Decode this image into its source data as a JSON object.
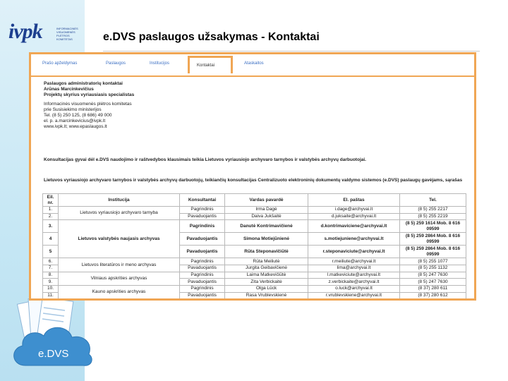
{
  "slide_title": "e.DVS paslaugos užsakymas - Kontaktai",
  "logo": {
    "main": "ivpk",
    "side_text": "INFORMACINĖS VISUOMENĖS PLĖTROS KOMITETAS"
  },
  "cloud_label": "e.DVS",
  "tabs": [
    {
      "label": "Prašo apželdymas"
    },
    {
      "label": "Paslaugos"
    },
    {
      "label": "Institucijos"
    },
    {
      "label": "Kontaktai"
    },
    {
      "label": "Ataskaitos"
    }
  ],
  "contacts": {
    "heading": "Paslaugos administratorių kontaktai",
    "name": "Arūnas Marcinkevičius",
    "position": "Projektų skyrius vyriausiasis specialistas",
    "org_line1": "Informacinės visuomenės plėtros komitetas",
    "org_line2": "prie Susisiekimo ministerijos",
    "phone": "Tel. (8 5) 250 125, (8 686) 49 000",
    "email": "el. p. a.marcinkevicius@ivpk.lt",
    "web": "www.ivpk.lt; www.epaslaugos.lt"
  },
  "consult_text": "Konsultacijas gyvai dėl e.DVS naudojimo ir raštvedybos klausimais teikia Lietuvos vyriausiojo archyvaro tarnybos ir valstybės archyvų darbuotojai.",
  "intro_text": "Lietuvos vyriausiojo archyvaro tarnybos ir valstybės archyvų darbuotojų, teikiančių konsultacijas Centralizuoto elektroninių dokumentų valdymo sistemos (e.DVS) paslaugų gavėjams, sąrašas",
  "table": {
    "headers": [
      "Eil. nr.",
      "Institucija",
      "Konsultantai",
      "Vardas pavardė",
      "El. paštas",
      "Tel."
    ],
    "rows": [
      {
        "nr": "1.",
        "inst": "Lietuvos vyriausiojo archyvaro tarnyba",
        "role": "Pagrindinis",
        "name": "Irma Dagė",
        "email": "i.dage@archyvai.lt",
        "tel": "(8 5) 255 2217"
      },
      {
        "nr": "2.",
        "inst": "",
        "role": "Pavaduojantis",
        "name": "Daiva Jukšaitė",
        "email": "d.juksaite@archyvai.lt",
        "tel": "(8 5) 255 2219"
      },
      {
        "nr": "3.",
        "inst": "",
        "role": "Pagrindinis",
        "name": "Danutė Kontrimavičienė",
        "email": "d.kontrimaviciene@archyvai.lt",
        "tel": "(8 5) 259 1614 Mob. 8 616 09599"
      },
      {
        "nr": "4",
        "inst": "Lietuvos valstybės naujasis archyvas",
        "role": "Pavaduojantis",
        "name": "Simona Motiejūnienė",
        "email": "s.motiejuniene@archyvai.lt",
        "tel": "(8 5) 259 2864 Mob. 8 616 09599"
      },
      {
        "nr": "5",
        "inst": "",
        "role": "Pavaduojantis",
        "name": "Rūta Steponavičiūtė",
        "email": "r.steponaviciute@archyvai.lt",
        "tel": "(8 5) 259 2864 Mob. 8 616 09599"
      },
      {
        "nr": "6.",
        "inst": "Lietuvos literatūros ir meno archyvas",
        "role": "Pagrindinis",
        "name": "Rūta Meiliutė",
        "email": "r.meiliute@archyvai.lt",
        "tel": "(8 5) 255 1077"
      },
      {
        "nr": "7.",
        "inst": "",
        "role": "Pavaduojantis",
        "name": "Jurgita Geibavičienė",
        "email": "lima@archyvai.lt",
        "tel": "(8 5) 255 1132"
      },
      {
        "nr": "8.",
        "inst": "Vilniaus apskrities archyvas",
        "role": "Pagrindinis",
        "name": "Laima Matkevičiūtė",
        "email": "l.matkeviciute@archyvai.lt",
        "tel": "(8 5) 247 7630"
      },
      {
        "nr": "9.",
        "inst": "",
        "role": "Pavaduojantis",
        "name": "Zita Verbickaitė",
        "email": "z.verbickaite@archyvai.lt",
        "tel": "(8 5) 247 7630"
      },
      {
        "nr": "10.",
        "inst": "Kauno apskrities archyvas",
        "role": "Pagrindinis",
        "name": "Olga Lūck",
        "email": "o.luck@archyvai.lt",
        "tel": "(8 37) 280 611"
      },
      {
        "nr": "11.",
        "inst": "",
        "role": "Pavaduojantis",
        "name": "Rasa Vrublevskienė",
        "email": "r.vrublevskiene@archyvai.lt",
        "tel": "(8 37) 280 612"
      }
    ]
  }
}
